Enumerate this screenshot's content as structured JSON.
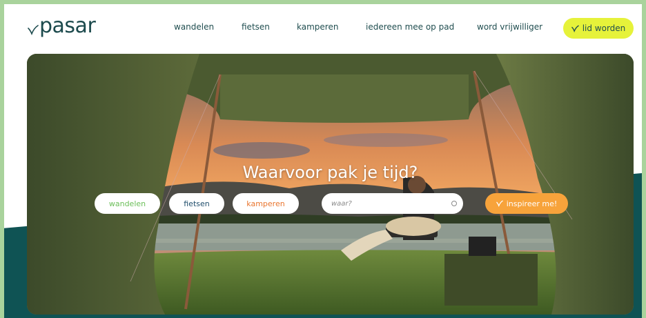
{
  "brand": {
    "name": "pasar",
    "accent": "#e6f23a",
    "teal": "#0f5354",
    "orange": "#f7a33b"
  },
  "nav": {
    "items": [
      {
        "label": "wandelen"
      },
      {
        "label": "fietsen"
      },
      {
        "label": "kamperen"
      },
      {
        "label": "iedereen mee op pad"
      },
      {
        "label": "word vrijwilliger"
      }
    ],
    "cta_label": "lid worden",
    "cta_icon": "leaf-icon"
  },
  "hero": {
    "headline": "Waarvoor pak je tijd?",
    "chips": [
      {
        "label": "wandelen",
        "color": "#6bbf59"
      },
      {
        "label": "fietsen",
        "color": "#1f4d6b"
      },
      {
        "label": "kamperen",
        "color": "#e9752e"
      }
    ],
    "search_placeholder": "waar?",
    "search_icon": "location-icon",
    "inspire_label": "inspireer me!",
    "inspire_icon": "leaf-icon"
  }
}
